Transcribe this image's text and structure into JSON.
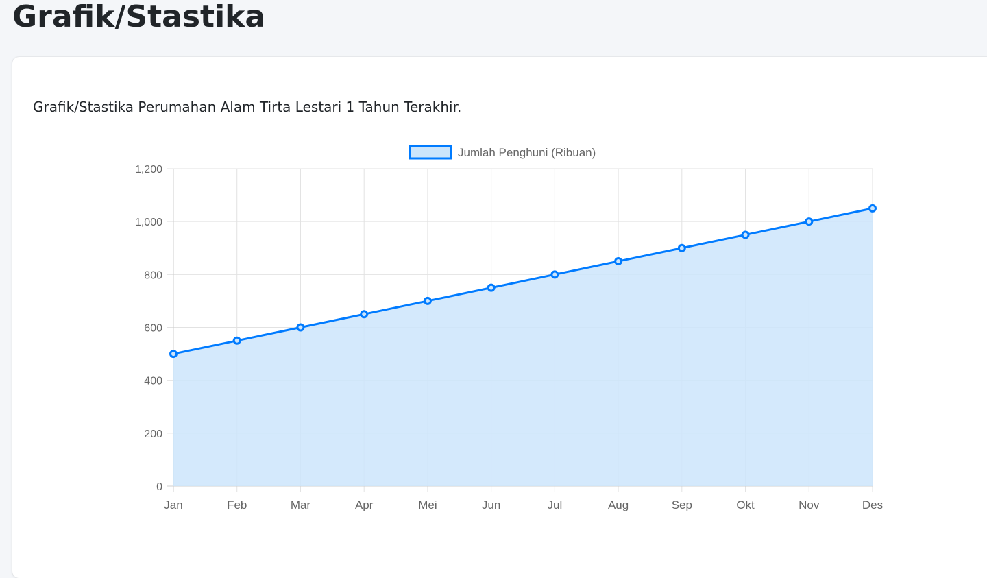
{
  "page": {
    "title": "Grafik/Stastika"
  },
  "card": {
    "description": "Grafik/Stastika Perumahan Alam Tirta Lestari 1 Tahun Terakhir."
  },
  "chart_data": {
    "type": "area",
    "categories": [
      "Jan",
      "Feb",
      "Mar",
      "Apr",
      "Mei",
      "Jun",
      "Jul",
      "Aug",
      "Sep",
      "Okt",
      "Nov",
      "Des"
    ],
    "series": [
      {
        "name": "Jumlah Penghuni (Ribuan)",
        "values": [
          500,
          550,
          600,
          650,
          700,
          750,
          800,
          850,
          900,
          950,
          1000,
          1050
        ],
        "line_color": "#007bff",
        "fill_color": "#cce5fb"
      }
    ],
    "yticks": [
      "0",
      "200",
      "400",
      "600",
      "800",
      "1,000",
      "1,200"
    ],
    "ylim": [
      0,
      1200
    ],
    "grid": true,
    "legend_position": "top-center",
    "title": "",
    "xlabel": "",
    "ylabel": ""
  }
}
